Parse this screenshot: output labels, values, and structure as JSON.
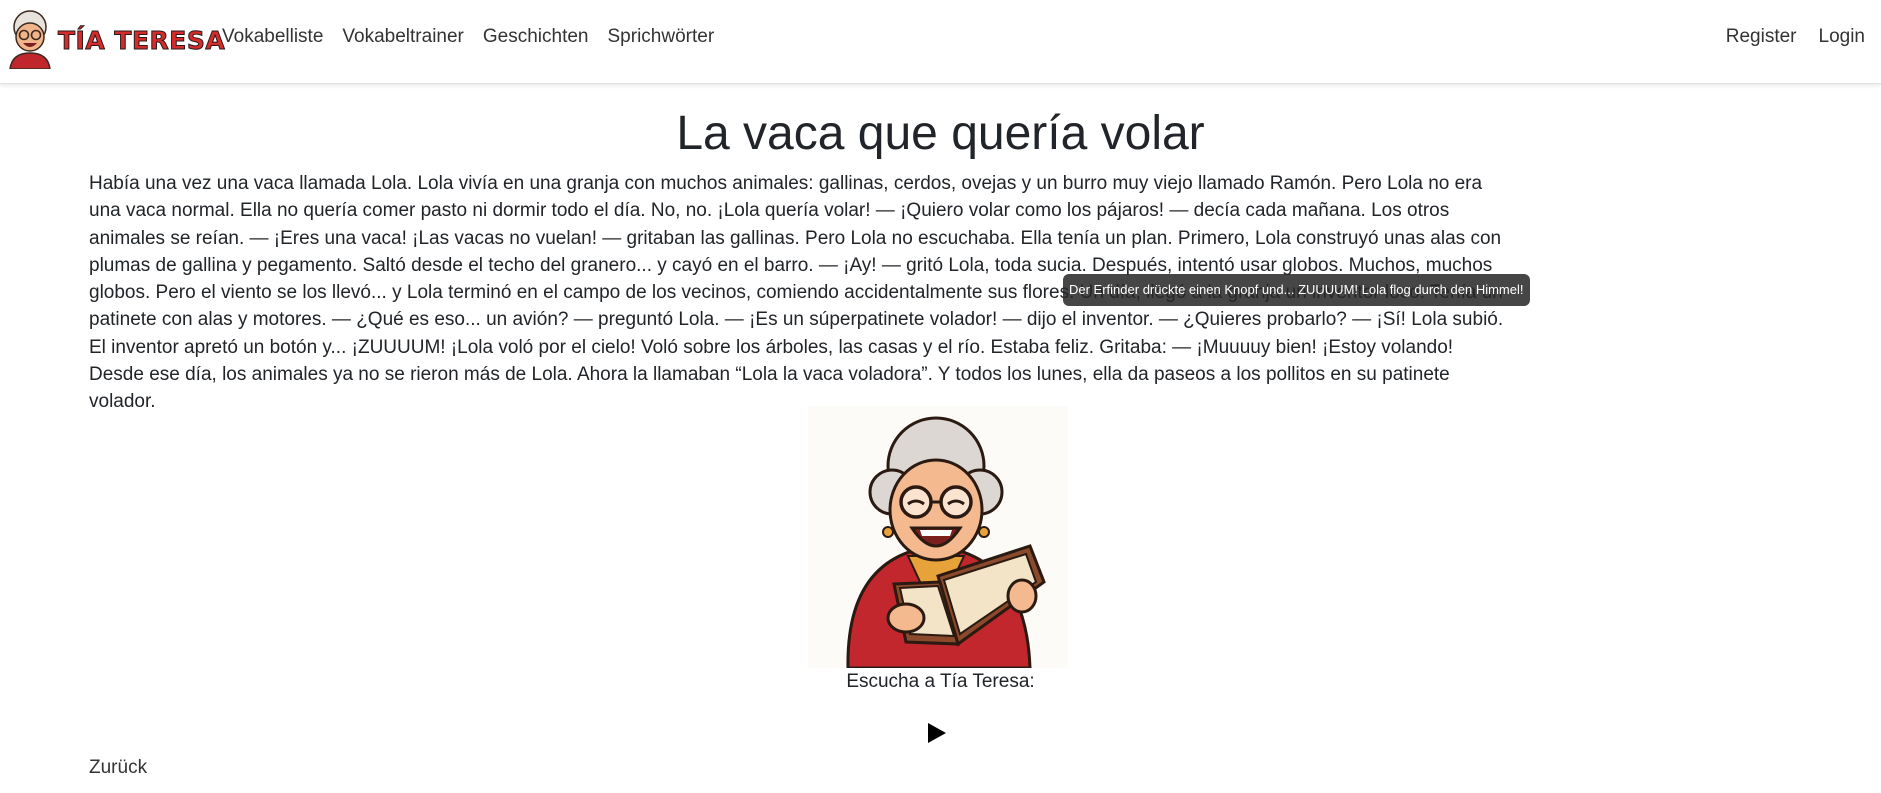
{
  "brand": {
    "name": "TÍA TERESA"
  },
  "nav": {
    "links": [
      "Vokabelliste",
      "Vokabeltrainer",
      "Geschichten",
      "Sprichwörter"
    ],
    "register": "Register",
    "login": "Login"
  },
  "story": {
    "title": "La vaca que quería volar",
    "text": "Había una vez una vaca llamada Lola. Lola vivía en una granja con muchos animales: gallinas, cerdos, ovejas y un burro muy viejo llamado Ramón. Pero Lola no era una vaca normal. Ella no quería comer pasto ni dormir todo el día. No, no. ¡Lola quería volar! — ¡Quiero volar como los pájaros! — decía cada mañana. Los otros animales se reían. — ¡Eres una vaca! ¡Las vacas no vuelan! — gritaban las gallinas. Pero Lola no escuchaba. Ella tenía un plan. Primero, Lola construyó unas alas con plumas de gallina y pegamento. Saltó desde el techo del granero... y cayó en el barro. — ¡Ay! — gritó Lola, toda sucia. Después, intentó usar globos. Muchos, muchos globos. Pero el viento se los llevó... y Lola terminó en el campo de los vecinos, comiendo accidentalmente sus flores. Un día, llegó a la granja un inventor loco. Tenía un patinete con alas y motores. — ¿Qué es eso... un avión? — preguntó Lola. — ¡Es un súperpatinete volador! — dijo el inventor. — ¿Quieres probarlo? — ¡Sí! Lola subió. El inventor apretó un botón y... ¡ZUUUUM! ¡Lola voló por el cielo! Voló sobre los árboles, las casas y el río. Estaba feliz. Gritaba: — ¡Muuuuy bien! ¡Estoy volando! Desde ese día, los animales ya no se rieron más de Lola. Ahora la llamaban “Lola la vaca voladora”. Y todos los lunes, ella da paseos a los pollitos en su patinete volador.",
    "tooltip": "Der Erfinder drückte einen Knopf und... ZUUUUM! Lola flog durch den Himmel!"
  },
  "audio": {
    "label": "Escucha a Tía Teresa:",
    "play_icon": "play-icon"
  },
  "back_link": "Zurück",
  "colors": {
    "brand_red": "#d62b2b",
    "text": "#212529",
    "tooltip_bg": "#282828"
  }
}
